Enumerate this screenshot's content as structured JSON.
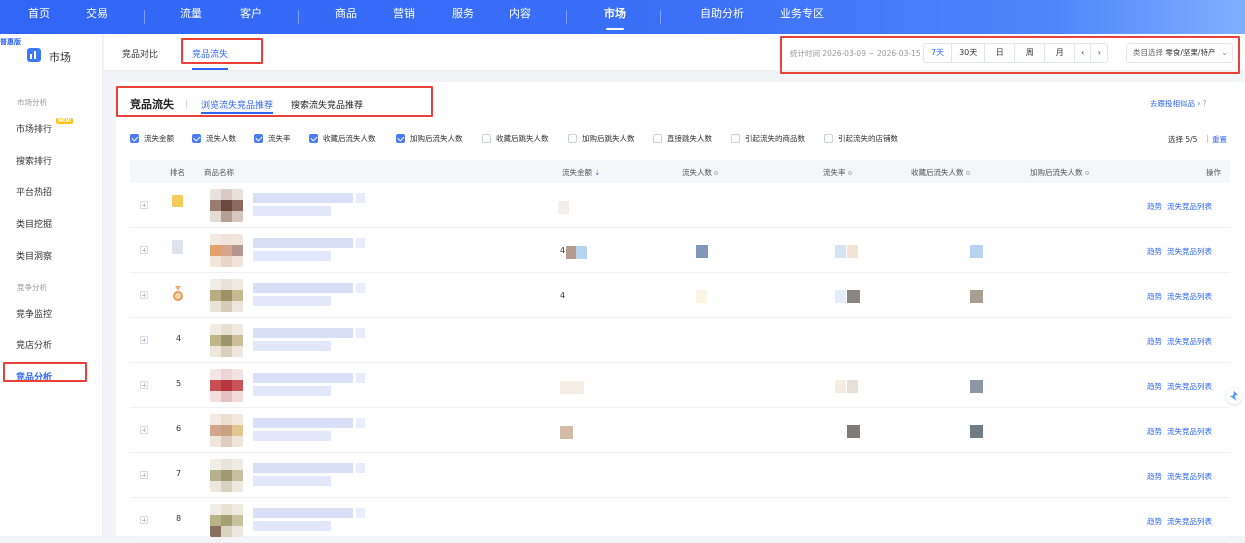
{
  "topnav": {
    "items": [
      "首页",
      "交易",
      "流量",
      "客户",
      "商品",
      "营销",
      "服务",
      "内容",
      "市场",
      "自助分析",
      "业务专区"
    ],
    "active": "市场"
  },
  "sidebar": {
    "version_badge": "普惠版",
    "title": "市场",
    "groups": [
      "市场分析",
      "竞争分析"
    ],
    "items": [
      "市场排行",
      "搜索排行",
      "平台热招",
      "类目挖掘",
      "类目洞察",
      "竞争监控",
      "竞店分析",
      "竞品分析"
    ],
    "new_tag": "NEW",
    "active": "竞品分析"
  },
  "subheader": {
    "tabs": [
      "竞品对比",
      "竞品流失"
    ],
    "active_tab": "竞品流失",
    "stat_time": "统计时间 2026-03-09 ~ 2026-03-15",
    "range_buttons": [
      "7天",
      "30天",
      "日",
      "周",
      "月",
      "‹",
      "›"
    ],
    "active_range": "7天",
    "category_label": "类目选择",
    "category_value": "零食/坚果/特产",
    "category_chevron": "chevron-down-icon"
  },
  "panel": {
    "title": "竞品流失",
    "tabs": [
      "浏览流失竞品推荐",
      "搜索流失竞品推荐"
    ],
    "active_tab": "浏览流失竞品推荐",
    "top_right_link": "去跟投相似品 ›",
    "help_icon": "?",
    "checkboxes": [
      {
        "label": "流失金额",
        "checked": true
      },
      {
        "label": "流失人数",
        "checked": true
      },
      {
        "label": "流失率",
        "checked": true
      },
      {
        "label": "收藏后流失人数",
        "checked": true
      },
      {
        "label": "加购后流失人数",
        "checked": true
      },
      {
        "label": "收藏后跳失人数",
        "checked": false
      },
      {
        "label": "加购后跳失人数",
        "checked": false
      },
      {
        "label": "直接跳失人数",
        "checked": false
      },
      {
        "label": "引起流失的商品数",
        "checked": false
      },
      {
        "label": "引起流失的店铺数",
        "checked": false
      }
    ],
    "selection_info": "选择 5/5",
    "reset_label": "重置"
  },
  "table": {
    "headers": {
      "rank": "排名",
      "name": "商品名称",
      "loss_amount": "流失金额",
      "loss_users": "流失人数",
      "loss_rate": "流失率",
      "fav_loss": "收藏后流失人数",
      "cart_loss": "加购后流失人数",
      "ops": "操作"
    },
    "rows": [
      {
        "rank": "",
        "op1": "趋势",
        "op2": "流失竞品列表"
      },
      {
        "rank": "",
        "op1": "趋势",
        "op2": "流失竞品列表"
      },
      {
        "rank": "",
        "op1": "趋势",
        "op2": "流失竞品列表"
      },
      {
        "rank": "4",
        "op1": "趋势",
        "op2": "流失竞品列表"
      },
      {
        "rank": "5",
        "op1": "趋势",
        "op2": "流失竞品列表"
      },
      {
        "rank": "6",
        "op1": "趋势",
        "op2": "流失竞品列表"
      },
      {
        "rank": "7",
        "op1": "趋势",
        "op2": "流失竞品列表"
      },
      {
        "rank": "8",
        "op1": "趋势",
        "op2": "流失竞品列表"
      }
    ]
  },
  "partial_value_glyphs": {
    "row2": "4",
    "row3": "4"
  }
}
